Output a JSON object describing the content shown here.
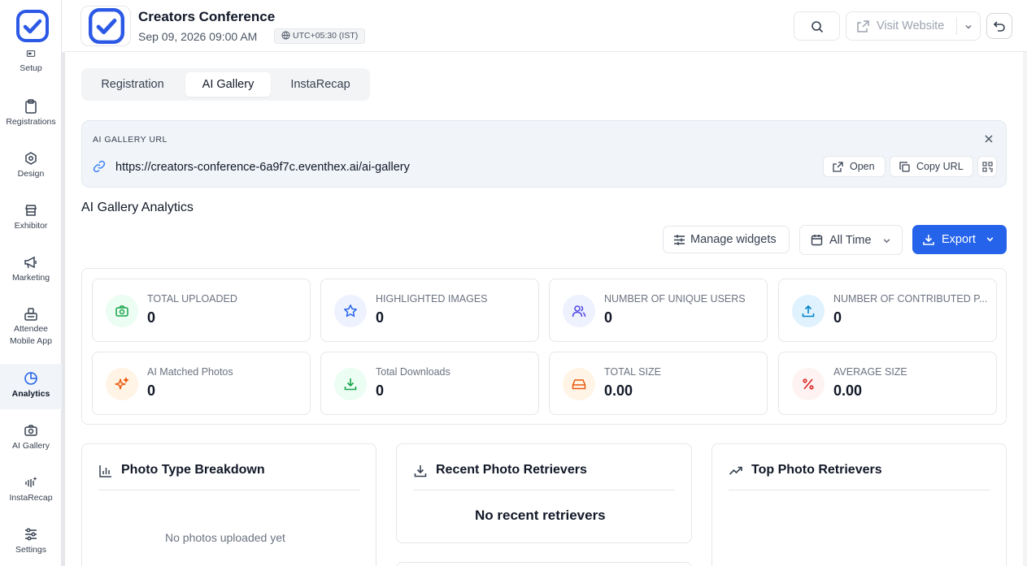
{
  "sidebar": {
    "items": [
      {
        "label": "Setup",
        "icon": "setup-icon"
      },
      {
        "label": "Registrations",
        "icon": "clipboard-icon"
      },
      {
        "label": "Design",
        "icon": "design-icon"
      },
      {
        "label": "Exhibitor",
        "icon": "store-icon"
      },
      {
        "label": "Marketing",
        "icon": "megaphone-icon"
      },
      {
        "label": "Attendee\nMobile App",
        "label_line1": "Attendee",
        "label_line2": "Mobile App",
        "icon": "mobile-app-icon"
      },
      {
        "label": "Analytics",
        "icon": "pie-chart-icon",
        "active": true
      },
      {
        "label": "AI Gallery",
        "icon": "camera-icon"
      },
      {
        "label": "InstaRecap",
        "icon": "sparkle-video-icon"
      },
      {
        "label": "Settings",
        "icon": "sliders-icon"
      }
    ]
  },
  "header": {
    "event_title": "Creators Conference",
    "event_date": "Sep 09, 2026 09:00 AM",
    "timezone": "UTC+05:30 (IST)",
    "visit_website_label": "Visit Website"
  },
  "tabs": [
    {
      "label": "Registration",
      "active": false
    },
    {
      "label": "AI Gallery",
      "active": true
    },
    {
      "label": "InstaRecap",
      "active": false
    }
  ],
  "url_box": {
    "label": "AI GALLERY URL",
    "url": "https://creators-conference-6a9f7c.eventhex.ai/ai-gallery",
    "open_label": "Open",
    "copy_label": "Copy URL"
  },
  "analytics": {
    "title": "AI Gallery Analytics",
    "manage_widgets_label": "Manage widgets",
    "time_filter": "All Time",
    "export_label": "Export",
    "stats": [
      {
        "label": "TOTAL UPLOADED",
        "value": "0",
        "icon": "camera-icon",
        "color": "#16a34a",
        "bg": "#ecfdf3"
      },
      {
        "label": "HIGHLIGHTED IMAGES",
        "value": "0",
        "icon": "star-icon",
        "color": "#2563eb",
        "bg": "#eef2ff"
      },
      {
        "label": "NUMBER OF UNIQUE USERS",
        "value": "0",
        "icon": "users-icon",
        "color": "#4f46e5",
        "bg": "#eef2ff"
      },
      {
        "label": "NUMBER OF CONTRIBUTED P...",
        "value": "0",
        "icon": "upload-icon",
        "color": "#0284c7",
        "bg": "#e0f2fe"
      },
      {
        "label": "AI Matched Photos",
        "value": "0",
        "icon": "sparkles-icon",
        "color": "#ea580c",
        "bg": "#fff4e6"
      },
      {
        "label": "Total Downloads",
        "value": "0",
        "icon": "download-icon",
        "color": "#16a34a",
        "bg": "#ecfdf3"
      },
      {
        "label": "TOTAL SIZE",
        "value": "0.00",
        "icon": "hard-drive-icon",
        "color": "#ea580c",
        "bg": "#fff4e6"
      },
      {
        "label": "AVERAGE SIZE",
        "value": "0.00",
        "icon": "percent-icon",
        "color": "#dc2626",
        "bg": "#fef2f2"
      }
    ]
  },
  "cards": {
    "photo_type": {
      "title": "Photo Type Breakdown",
      "empty": "No photos uploaded yet"
    },
    "recent": {
      "title": "Recent Photo Retrievers",
      "empty": "No recent retrievers"
    },
    "top": {
      "title": "Top Photo Retrievers"
    }
  },
  "colors": {
    "accent": "#2563eb",
    "brand": "#2b59e6"
  }
}
